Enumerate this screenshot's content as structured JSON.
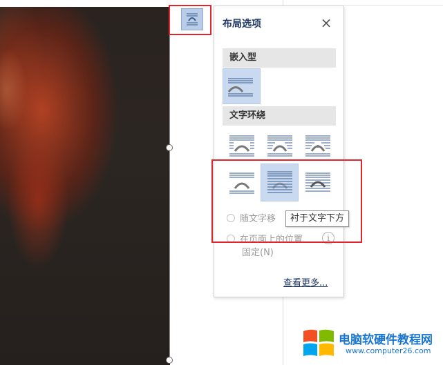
{
  "panel": {
    "title": "布局选项",
    "close_icon": "close-x-icon",
    "section_inline": "嵌入型",
    "section_wrap": "文字环绕",
    "radio_move_with_text": "随文字移",
    "radio_fix_position_line1": "在页面上的位置",
    "radio_fix_position_line2": "固定(N)",
    "see_more": "查看更多...",
    "info_icon": "i"
  },
  "tooltip": "衬于文字下方",
  "layout_button_icon": "layout-options-icon",
  "watermark": {
    "title": "电脑软硬件教程网",
    "url": "www.computer26.com"
  },
  "colors": {
    "accent_blue": "#1f3864",
    "selected_bg": "#c8d9f0",
    "highlight_red": "#e0252e",
    "watermark_blue": "#1976d2"
  }
}
